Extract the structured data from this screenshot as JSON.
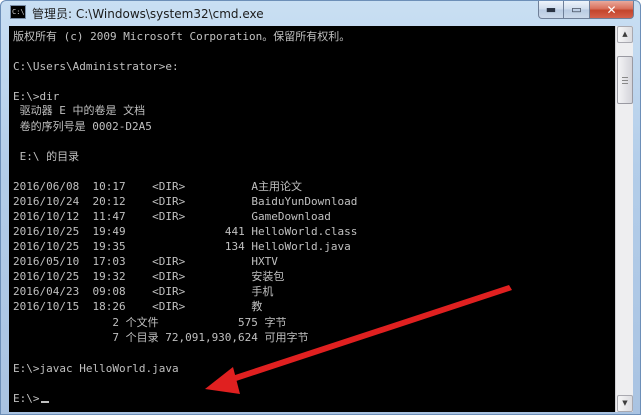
{
  "window": {
    "title": "管理员: C:\\Windows\\system32\\cmd.exe",
    "icon_text": "C:\\"
  },
  "caption": {
    "minimize": "▬",
    "maximize": "▭",
    "close": "✕"
  },
  "console": {
    "lines": [
      "版权所有 (c) 2009 Microsoft Corporation。保留所有权利。",
      "C:\\Users\\Administrator>e:",
      "E:\\>dir",
      " 驱动器 E 中的卷是 文档",
      " 卷的序列号是 0002-D2A5",
      " E:\\ 的目录",
      "2016/06/08  10:17    <DIR>          A主用论文",
      "2016/10/24  20:12    <DIR>          BaiduYunDownload",
      "2016/10/12  11:47    <DIR>          GameDownload",
      "2016/10/25  19:49               441 HelloWorld.class",
      "2016/10/25  19:35               134 HelloWorld.java",
      "2016/05/10  17:03    <DIR>          HXTV",
      "2016/10/25  19:32    <DIR>          安装包",
      "2016/04/23  09:08    <DIR>          手机",
      "2016/10/15  18:26    <DIR>          教",
      "               2 个文件            575 字节",
      "               7 个目录 72,091,930,624 可用字节",
      "E:\\>javac HelloWorld.java",
      "E:\\>"
    ]
  },
  "scrollbar": {
    "up": "▲",
    "down": "▼"
  },
  "colors": {
    "console_bg": "#000000",
    "console_text": "#c0c0c0",
    "arrow": "#e02020"
  }
}
